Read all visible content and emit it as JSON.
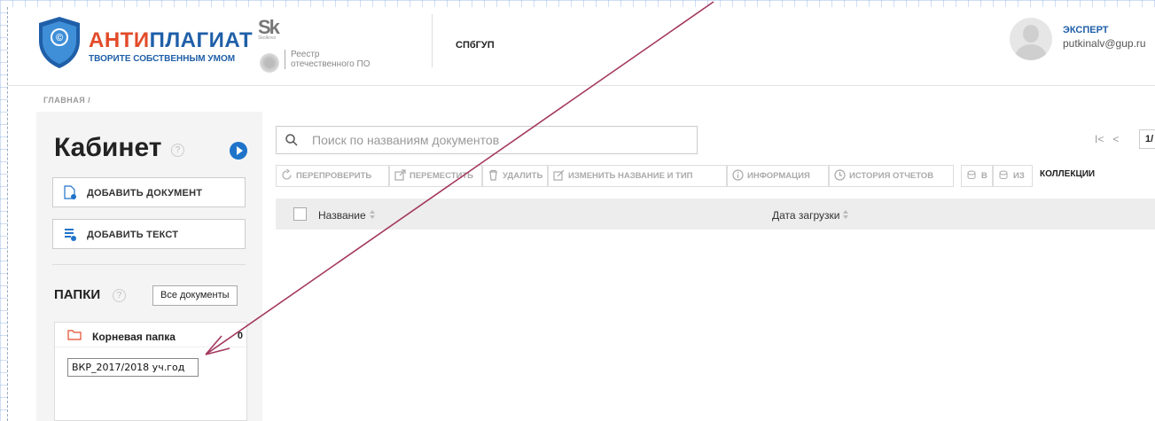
{
  "header": {
    "brand_accent": "АНТИ",
    "brand_main": "ПЛАГИАТ",
    "tagline": "ТВОРИТЕ СОБСТВЕННЫМ УМОМ",
    "sk_logo": "Sk",
    "sk_subtitle": "Skolkovo",
    "registry_line1": "Реестр",
    "registry_line2": "отечественного ПО",
    "organization": "СПбГУП",
    "user_role": "ЭКСПЕРТ",
    "user_email": "putkinalv@gup.ru"
  },
  "breadcrumb": "ГЛАВНАЯ /",
  "sidebar": {
    "title": "Кабинет",
    "help": "?",
    "add_document": "ДОБАВИТЬ ДОКУМЕНТ",
    "add_text": "ДОБАВИТЬ ТЕКСТ",
    "folders_title": "ПАПКИ",
    "all_documents": "Все документы",
    "root_folder": "Корневая папка",
    "root_folder_count": "0",
    "new_folder_value": "ВКР_2017/2018 уч.год"
  },
  "search": {
    "placeholder": "Поиск по названиям документов"
  },
  "pager": {
    "first": "I<",
    "prev": "<",
    "page": "1/"
  },
  "toolbar": {
    "recheck": "ПЕРЕПРОВЕРИТЬ",
    "move": "ПЕРЕМЕСТИТЬ",
    "delete": "УДАЛИТЬ",
    "rename": "ИЗМЕНИТЬ НАЗВАНИЕ И ТИП",
    "info": "ИНФОРМАЦИЯ",
    "history": "ИСТОРИЯ ОТЧЕТОВ",
    "to_collection": "В",
    "from_collection": "ИЗ",
    "collections": "КОЛЛЕКЦИИ"
  },
  "table": {
    "columns": [
      "Название",
      "Дата загрузки"
    ]
  },
  "colors": {
    "brand_blue": "#1f5fa8",
    "brand_red": "#e24b2a",
    "annotation_arrow": "#a3385e"
  }
}
